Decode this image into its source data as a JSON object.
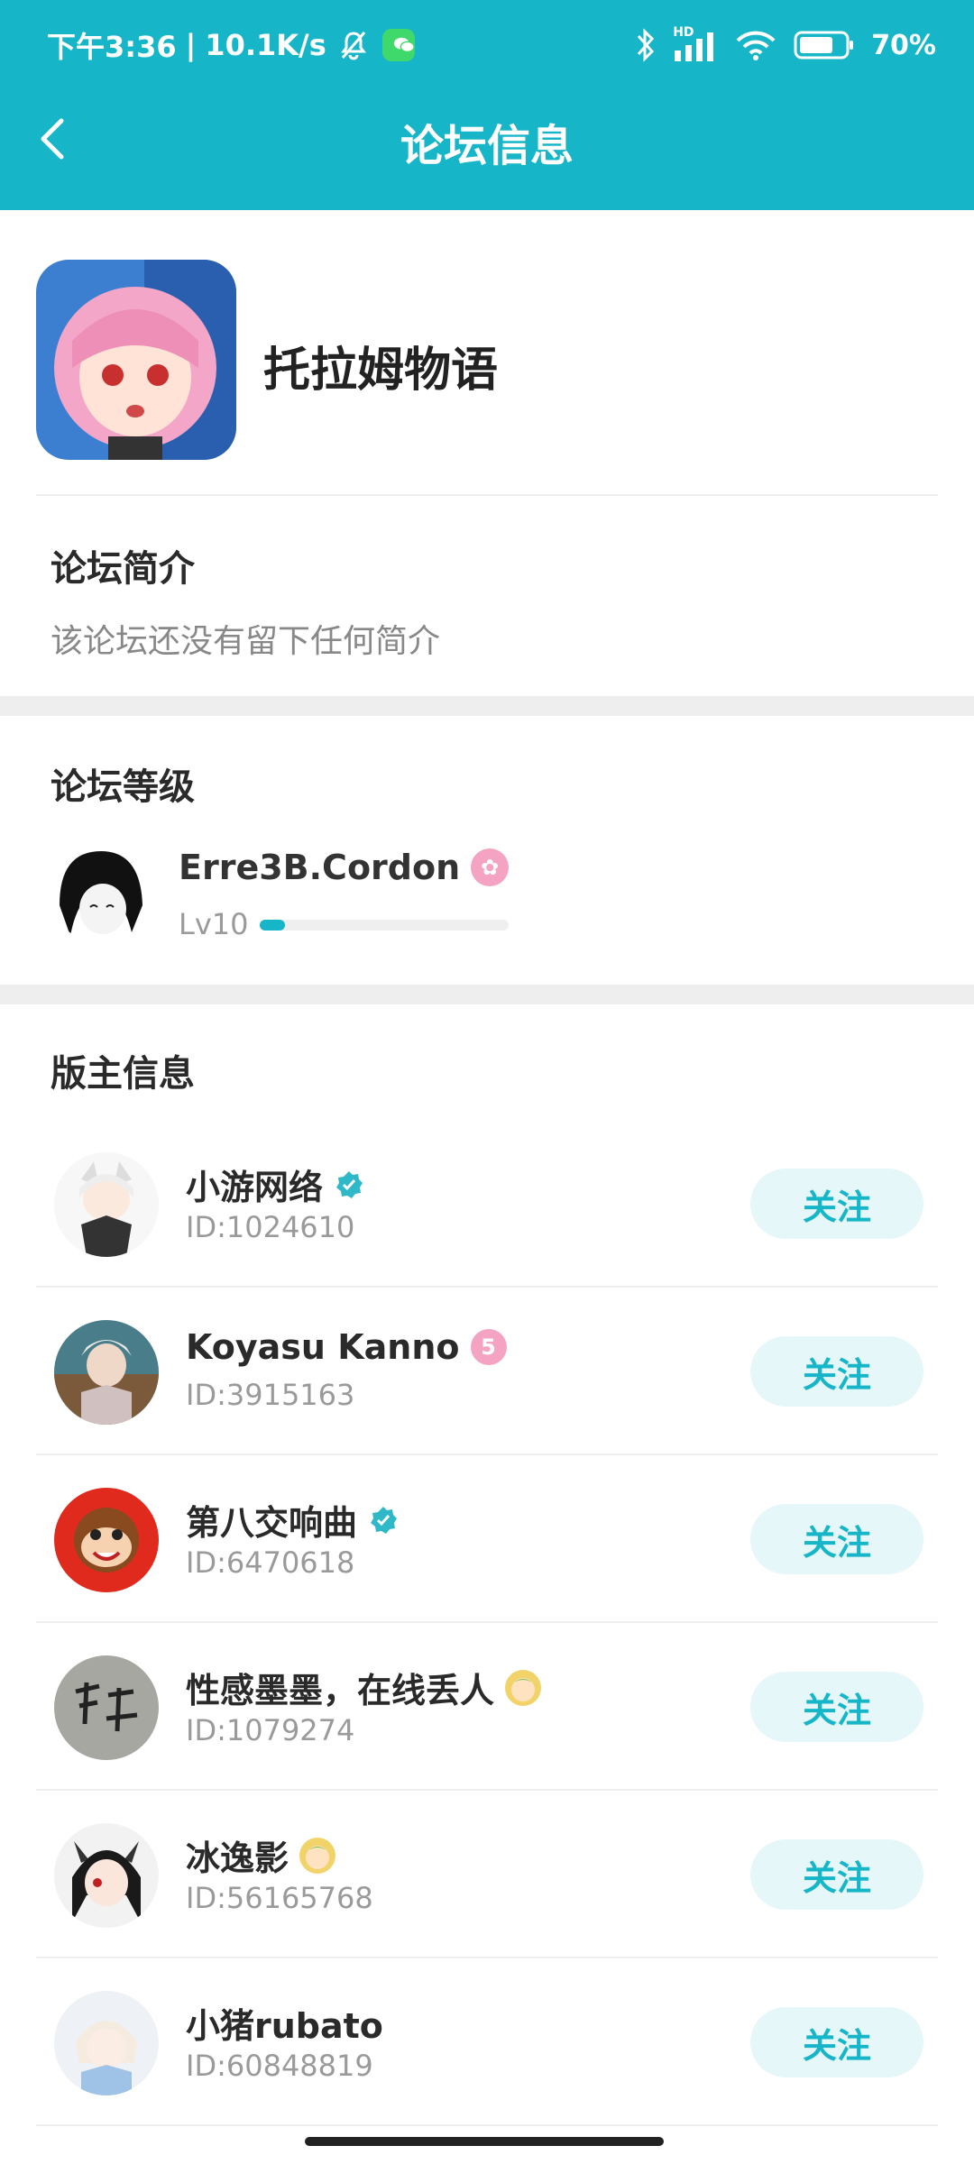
{
  "status_bar": {
    "time": "下午3:36",
    "speed": "10.1K/s",
    "battery": "70%",
    "net_label": "HD"
  },
  "header": {
    "title": "论坛信息"
  },
  "forum": {
    "name": "托拉姆物语"
  },
  "intro": {
    "title": "论坛简介",
    "text": "该论坛还没有留下任何简介"
  },
  "level": {
    "title": "论坛等级",
    "user": "Erre3B.Cordon",
    "level_text": "Lv10",
    "progress": 0.1
  },
  "moderators": {
    "title": "版主信息",
    "follow_label": "关注",
    "items": [
      {
        "name": "小游网络",
        "id": "ID:1024610",
        "badge": "verified"
      },
      {
        "name": "Koyasu Kanno",
        "id": "ID:3915163",
        "badge": "pink-level"
      },
      {
        "name": "第八交响曲",
        "id": "ID:6470618",
        "badge": "verified"
      },
      {
        "name": "性感墨墨，在线丢人",
        "id": "ID:1079274",
        "badge": "avatar-emoji"
      },
      {
        "name": "冰逸影",
        "id": "ID:56165768",
        "badge": "avatar-emoji"
      },
      {
        "name": "小猪rubato",
        "id": "ID:60848819",
        "badge": "none"
      }
    ]
  },
  "colors": {
    "accent": "#16b6c8",
    "follow_bg": "#e6f7f9",
    "verified": "#2fb8c8",
    "pink": "#f4a4c2"
  }
}
